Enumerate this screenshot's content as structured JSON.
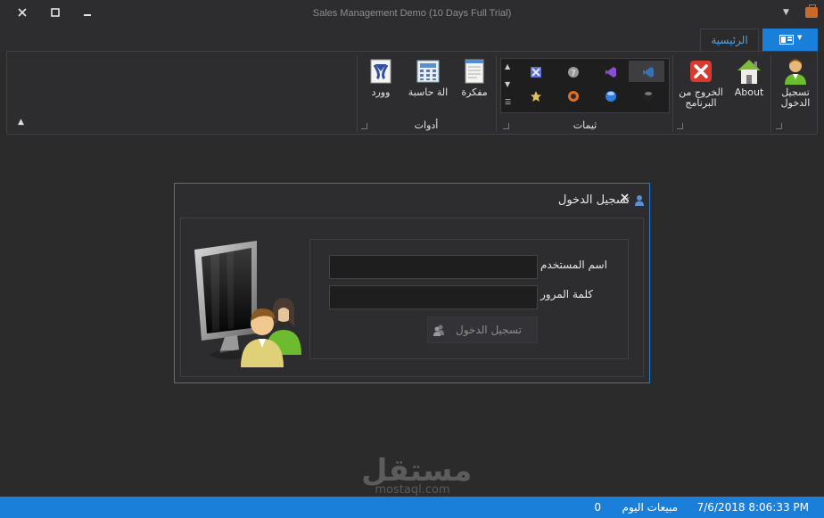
{
  "window": {
    "title": "Sales Management Demo (10 Days Full Trial)"
  },
  "ribbon": {
    "file_icon": "menu-book-icon",
    "tabs": [
      {
        "label": "الرئيسية",
        "active": true
      }
    ],
    "groups": {
      "account": {
        "login_label": "تسجيل الدخول",
        "about_label": "About",
        "exit_label": "الخروج من البرنامج"
      },
      "themes": {
        "caption": "ثيمات"
      },
      "tools": {
        "caption": "أدوات",
        "notebook_label": "مفكرة",
        "calculator_label": "الة حاسبة",
        "word_label": "وورد"
      }
    }
  },
  "login_dialog": {
    "title": "تسجيل الدخول",
    "username_label": "اسم المستخدم",
    "password_label": "كلمة المرور",
    "username_value": "",
    "password_value": "",
    "login_button": "تسجيل الدخول"
  },
  "status": {
    "datetime": "7/6/2018 8:06:33 PM",
    "sales_today_label": "مبيعات اليوم",
    "sales_today_value": "0"
  },
  "watermark": {
    "arabic": "مستقل",
    "latin": "mostaql.com"
  },
  "colors": {
    "accent": "#1a7fd8",
    "background": "#2b2b2b",
    "panel": "#2d2d30"
  }
}
